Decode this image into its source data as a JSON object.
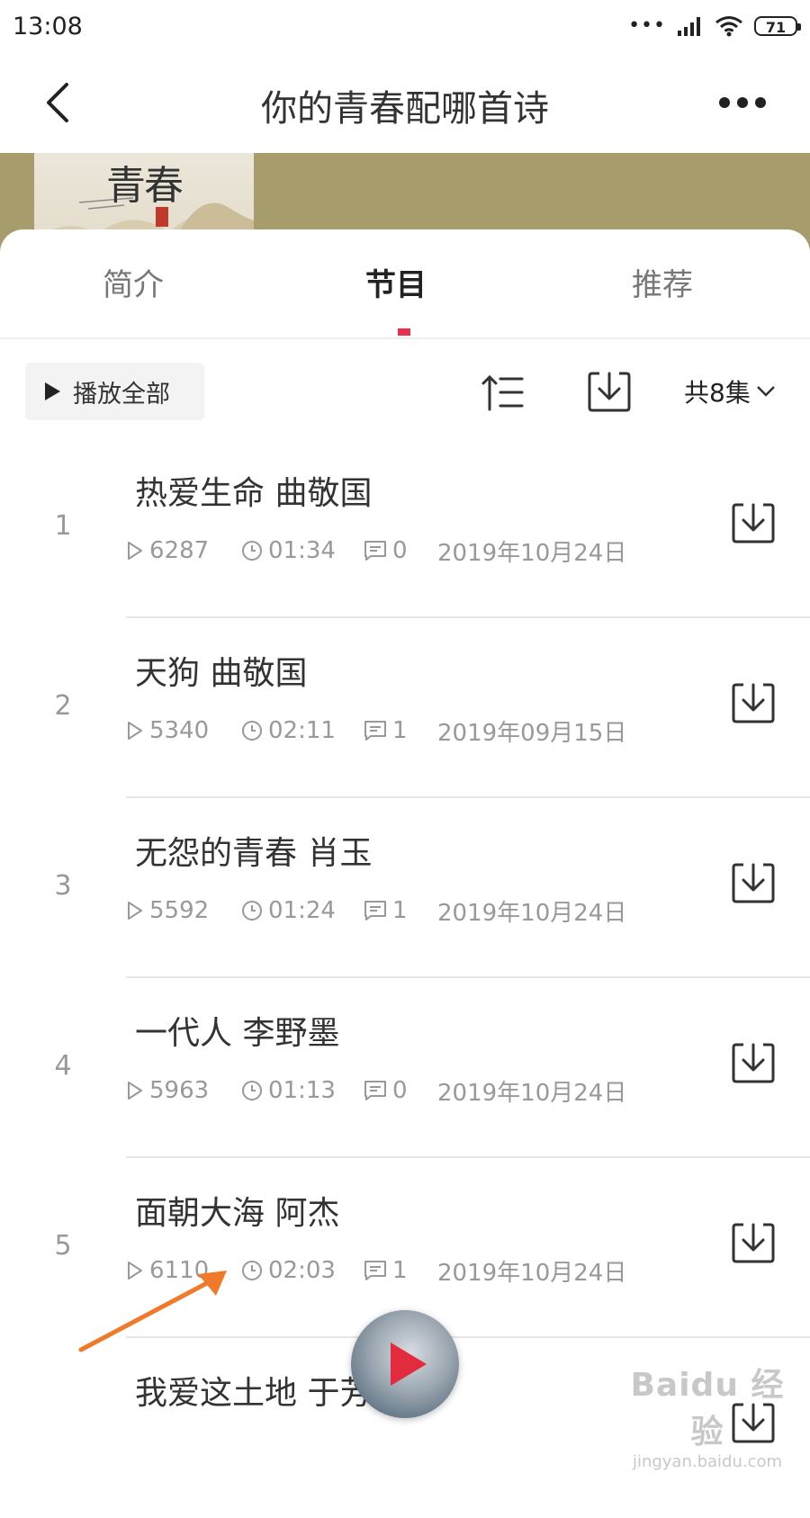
{
  "status_bar": {
    "time": "13:08",
    "battery": "71",
    "signal_dots": "•••"
  },
  "header": {
    "title": "你的青春配哪首诗",
    "back_icon": "chevron-left-icon",
    "more_icon": "more-dots-icon"
  },
  "banner": {
    "cover_text": "青春",
    "background_color": "#a79d6c"
  },
  "tabs": [
    {
      "label": "简介",
      "active": false
    },
    {
      "label": "节目",
      "active": true
    },
    {
      "label": "推荐",
      "active": false
    }
  ],
  "accent_color": "#e8304e",
  "toolbar": {
    "play_all_label": "播放全部",
    "count_label": "共8集"
  },
  "episodes": [
    {
      "num": "1",
      "title": "热爱生命 曲敬国",
      "plays": "6287",
      "duration": "01:34",
      "comments": "0",
      "date": "2019年10月24日"
    },
    {
      "num": "2",
      "title": "天狗 曲敬国",
      "plays": "5340",
      "duration": "02:11",
      "comments": "1",
      "date": "2019年09月15日"
    },
    {
      "num": "3",
      "title": "无怨的青春 肖玉",
      "plays": "5592",
      "duration": "01:24",
      "comments": "1",
      "date": "2019年10月24日"
    },
    {
      "num": "4",
      "title": "一代人 李野墨",
      "plays": "5963",
      "duration": "01:13",
      "comments": "0",
      "date": "2019年10月24日"
    },
    {
      "num": "5",
      "title": "面朝大海 阿杰",
      "plays": "6110",
      "duration": "02:03",
      "comments": "1",
      "date": "2019年10月24日"
    },
    {
      "num": "",
      "title": "我爱这土地 于芳",
      "plays": "",
      "duration": "",
      "comments": "",
      "date": ""
    }
  ],
  "watermark": {
    "main": "Baidu 经验",
    "sub": "jingyan.baidu.com"
  }
}
